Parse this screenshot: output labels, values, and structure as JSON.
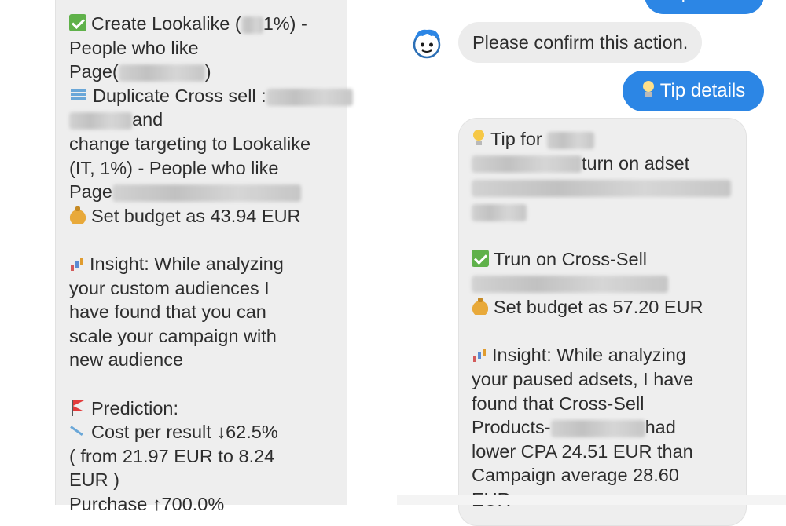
{
  "left_message": {
    "lines": [
      {
        "icon": "check-icon",
        "text": "Create Lookalike (",
        "blur": true,
        "tail": "1%) -"
      },
      {
        "text": "People who like"
      },
      {
        "text": "Page(",
        "blur": true,
        "tail": ")"
      },
      {
        "icon": "email-icon",
        "text": "Duplicate Cross sell :",
        "blur": true,
        "tail": ""
      },
      {
        "text": "",
        "blur": true,
        "tail": "and"
      },
      {
        "text": "change targeting to Lookalike"
      },
      {
        "text": "(IT, 1%) - People who like"
      },
      {
        "text": "Page",
        "blur": true,
        "tail": ""
      },
      {
        "icon": "moneybag-icon",
        "text": "Set budget as 43.94 EUR"
      },
      {
        "text": ""
      },
      {
        "icon": "chart-icon",
        "text": "Insight:  While analyzing"
      },
      {
        "text": "your custom audiences I"
      },
      {
        "text": "have found that you can"
      },
      {
        "text": "scale your campaign with"
      },
      {
        "text": "new audience"
      },
      {
        "text": ""
      },
      {
        "icon": "flag-icon",
        "text": "Prediction:"
      },
      {
        "icon": "chart-down-icon",
        "text": "Cost per result  ↓62.5%"
      },
      {
        "text": "( from 21.97 EUR to 8.24"
      },
      {
        "text": "EUR )"
      },
      {
        "text": "Purchase  ↑700.0%"
      }
    ]
  },
  "right": {
    "top_button": "Implement",
    "confirm_text": "Please confirm this action.",
    "tip_button": "Tip details",
    "message_lines": [
      {
        "icon": "bulb-icon",
        "text": "Tip for ",
        "blur": true,
        "tail": ""
      },
      {
        "text": "",
        "blur": true,
        "tail": "turn on adset"
      },
      {
        "text": "",
        "blur": true,
        "tail": ""
      },
      {
        "text": "",
        "blur": true,
        "tail": ""
      },
      {
        "text": ""
      },
      {
        "icon": "check-icon",
        "text": "Trun on Cross-Sell"
      },
      {
        "text": "",
        "blur": true,
        "tail": ""
      },
      {
        "icon": "moneybag-icon",
        "text": "Set budget as 57.20 EUR"
      },
      {
        "text": ""
      },
      {
        "icon": "chart-icon",
        "text": "Insight:  While analyzing"
      },
      {
        "text": "your paused adsets, I have"
      },
      {
        "text": "found that Cross-Sell"
      },
      {
        "text": "Products-",
        "blur": true,
        "tail": "had"
      },
      {
        "text": "lower CPA 24.51 EUR than"
      },
      {
        "text": "Campaign average 28.60"
      },
      {
        "text": "EUR"
      }
    ]
  },
  "colors": {
    "accent_blue": "#2c86e5",
    "bubble_gray": "#eeeeee",
    "text": "#2d2d2d"
  }
}
